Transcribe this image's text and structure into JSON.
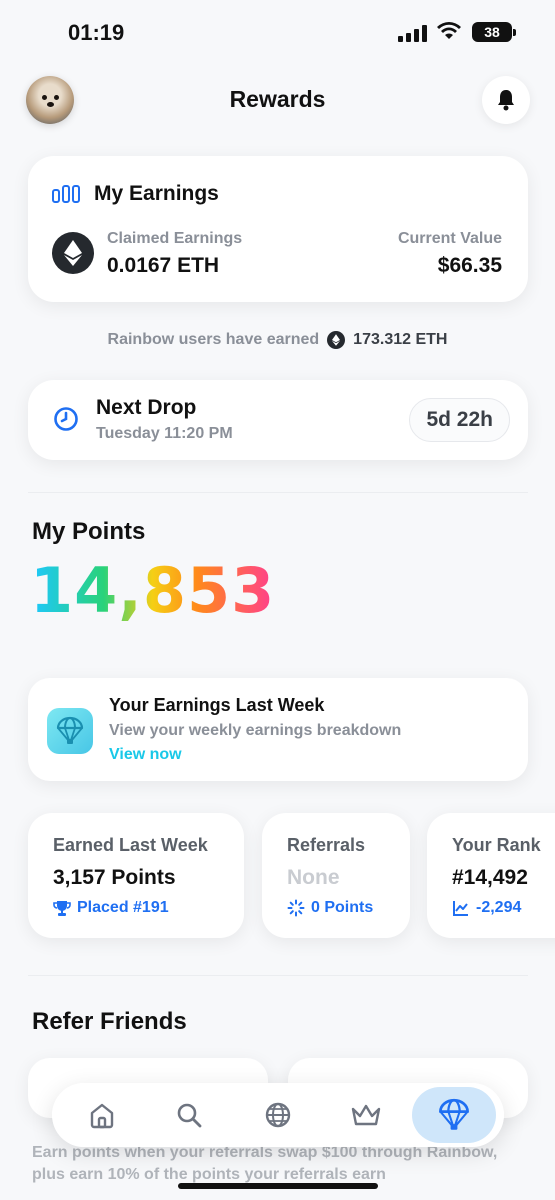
{
  "status_bar": {
    "time": "01:19",
    "battery": "38"
  },
  "header": {
    "title": "Rewards"
  },
  "earnings": {
    "title": "My Earnings",
    "claimed_label": "Claimed Earnings",
    "claimed_value": "0.0167 ETH",
    "current_label": "Current Value",
    "current_value": "$66.35"
  },
  "community": {
    "text": "Rainbow users have earned",
    "amount": "173.312 ETH"
  },
  "next_drop": {
    "title": "Next Drop",
    "subtitle": "Tuesday 11:20 PM",
    "countdown": "5d 22h"
  },
  "points": {
    "title": "My Points",
    "value": "14,853"
  },
  "weekly": {
    "title": "Your Earnings Last Week",
    "subtitle": "View your weekly earnings breakdown",
    "link": "View now"
  },
  "stats": [
    {
      "label": "Earned Last Week",
      "value": "3,157 Points",
      "sub": "Placed #191"
    },
    {
      "label": "Referrals",
      "value": "None",
      "sub": "0 Points"
    },
    {
      "label": "Your Rank",
      "value": "#14,492",
      "sub": "-2,294"
    }
  ],
  "refer": {
    "title": "Refer Friends",
    "footer": "Earn points when your referrals swap $100 through Rainbow, plus earn 10% of the points your referrals earn"
  },
  "tabbar": {
    "tabs": [
      "home-icon",
      "search-icon",
      "globe-icon",
      "crown-icon",
      "parachute-icon"
    ],
    "active": "parachute-icon",
    "active_color": "#1f6ff2"
  }
}
